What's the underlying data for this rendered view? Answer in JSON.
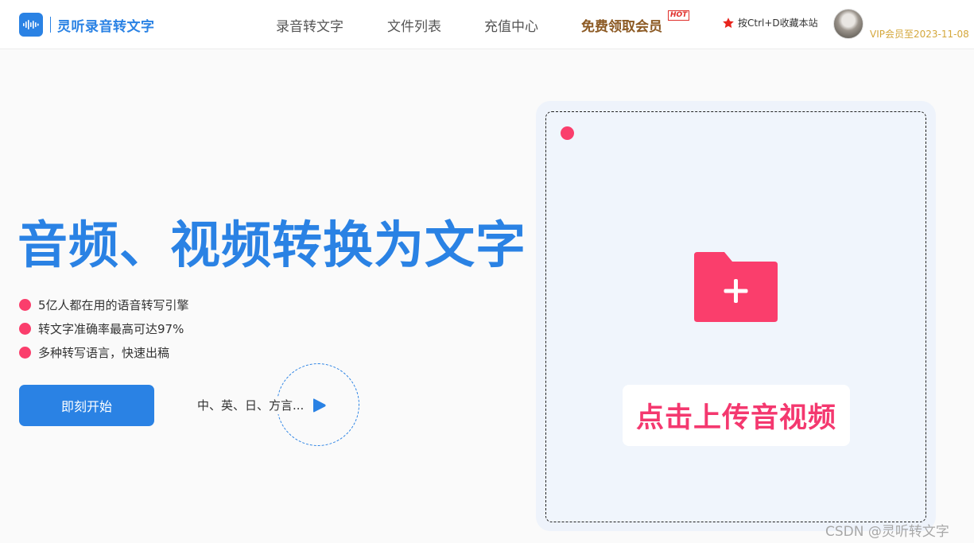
{
  "header": {
    "logo_text": "灵听录音转文字",
    "nav": [
      {
        "label": "录音转文字"
      },
      {
        "label": "文件列表"
      },
      {
        "label": "充值中心"
      },
      {
        "label": "免费领取会员"
      }
    ],
    "hot_badge": "HOT",
    "favorite_hint": "按Ctrl+D收藏本站",
    "username": "",
    "vip_expire": "VIP会员至2023-11-08"
  },
  "hero": {
    "title": "音频、视频转换为文字",
    "features": [
      "5亿人都在用的语音转写引擎",
      "转文字准确率最高可达97%",
      "多种转写语言，快速出稿"
    ],
    "start_button": "即刻开始",
    "languages": "中、英、日、方言..."
  },
  "upload": {
    "label": "点击上传音视频"
  },
  "watermark": "CSDN @灵听转文字",
  "colors": {
    "brand_blue": "#2a82e4",
    "accent_pink": "#fa3e6c",
    "vip_brown": "#8c5a24",
    "vip_gold": "#d4a73b"
  },
  "icons": [
    "audio-wave-icon",
    "star-icon",
    "play-icon",
    "folder-add-icon"
  ]
}
